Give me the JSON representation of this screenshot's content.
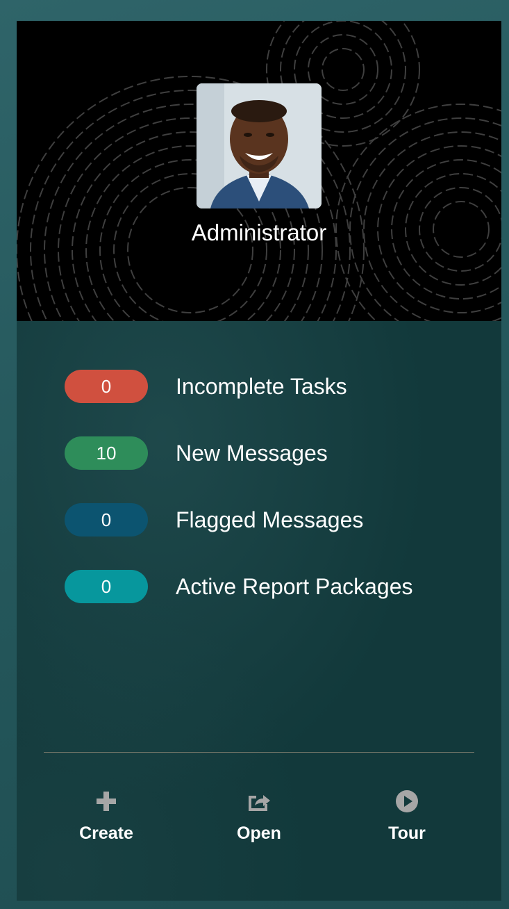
{
  "profile": {
    "name": "Administrator"
  },
  "stats": [
    {
      "count": "0",
      "label": "Incomplete Tasks",
      "color": "#d0503f"
    },
    {
      "count": "10",
      "label": "New Messages",
      "color": "#2e8d5a"
    },
    {
      "count": "0",
      "label": "Flagged Messages",
      "color": "#0c5470"
    },
    {
      "count": "0",
      "label": "Active Report Packages",
      "color": "#07979d"
    }
  ],
  "actions": {
    "create": {
      "label": "Create",
      "icon": "plus-icon"
    },
    "open": {
      "label": "Open",
      "icon": "share-open-icon"
    },
    "tour": {
      "label": "Tour",
      "icon": "play-circle-icon"
    }
  },
  "colors": {
    "panel_background": "#12393b",
    "header_background": "#000000",
    "icon_gray": "#a6a6a6"
  }
}
